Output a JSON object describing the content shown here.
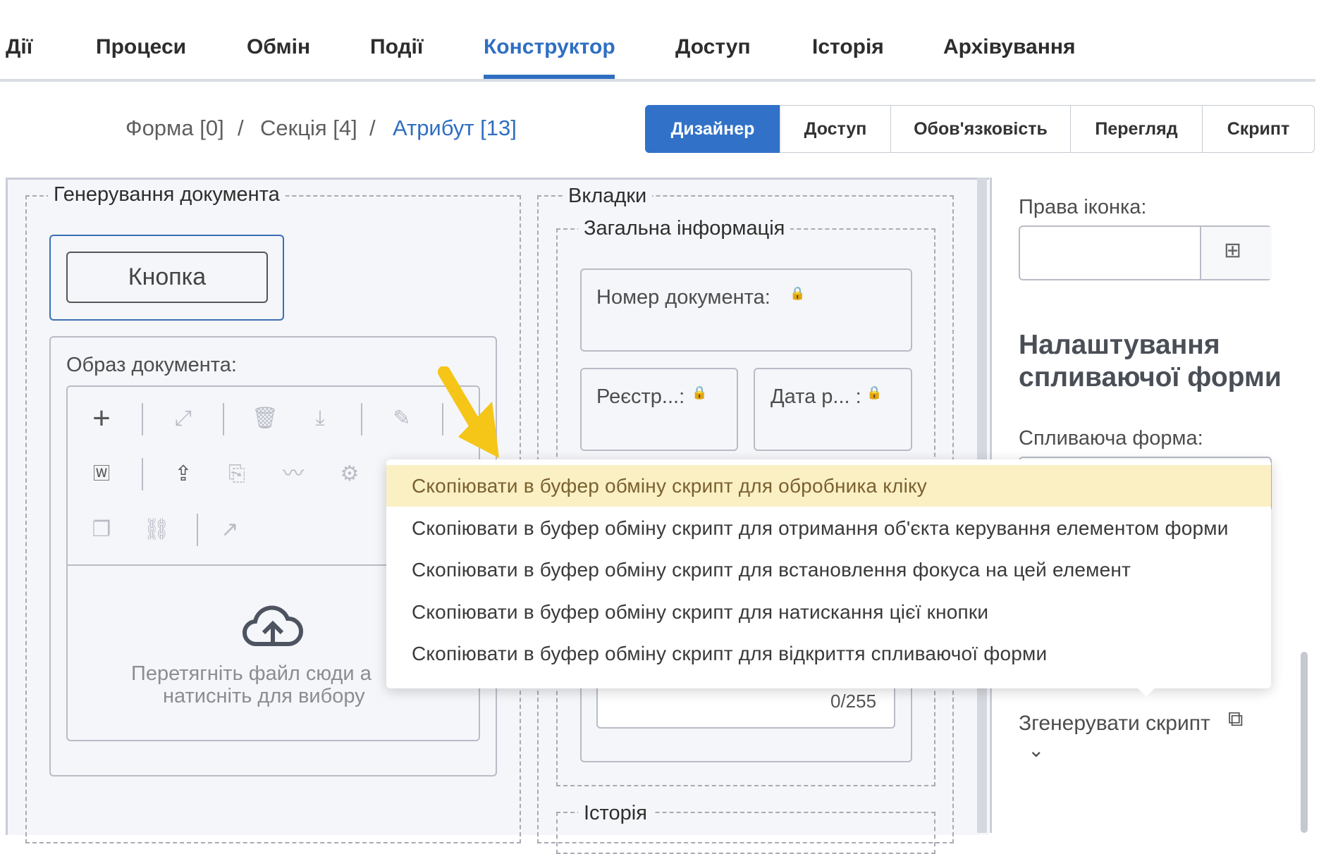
{
  "top_tabs": [
    {
      "label": "Дії"
    },
    {
      "label": "Процеси"
    },
    {
      "label": "Обмін"
    },
    {
      "label": "Події"
    },
    {
      "label": "Конструктор",
      "active": true
    },
    {
      "label": "Доступ"
    },
    {
      "label": "Історія"
    },
    {
      "label": "Архівування"
    }
  ],
  "breadcrumb": {
    "form": "Форма [0]",
    "section": "Секція [4]",
    "attribute": "Атрибут [13]",
    "separator": "/"
  },
  "mode_tabs": [
    {
      "label": "Дизайнер",
      "active": true
    },
    {
      "label": "Доступ"
    },
    {
      "label": "Обов'язковість"
    },
    {
      "label": "Перегляд"
    },
    {
      "label": "Скрипт"
    }
  ],
  "canvas": {
    "doc_gen_group": "Генерування документа",
    "button_label": "Кнопка",
    "doc_image_label": "Образ документа:",
    "upload_text_1": "Перетягніть файл сюди а",
    "upload_text_2": "натисніть для вибору",
    "tabs_group": "Вкладки",
    "general_info_group": "Загальна інформація",
    "doc_number_label": "Номер документа:",
    "reg_label": "Реєстр...:",
    "date_label": "Дата р... :",
    "char_counter": "0/255",
    "history_group": "Історія"
  },
  "right_panel": {
    "right_icon_label": "Права іконка:",
    "popup_settings_heading_1": "Налаштування",
    "popup_settings_heading_2": "спливаючої форми",
    "popup_form_label": "Спливаюча форма:",
    "generate_script_label": "Згенерувати скрипт"
  },
  "context_menu": {
    "items": [
      {
        "label": "Скопіювати в буфер обміну скрипт для обробника кліку",
        "highlighted": true
      },
      {
        "label": "Скопіювати в буфер обміну скрипт для отримання об'єкта керування елементом форми"
      },
      {
        "label": "Скопіювати в буфер обміну скрипт для встановлення фокуса на цей елемент"
      },
      {
        "label": "Скопіювати в буфер обміну скрипт для натискання цієї кнопки"
      },
      {
        "label": "Скопіювати в буфер обміну скрипт для відкриття спливаючої форми"
      }
    ]
  },
  "colors": {
    "accent": "#2f6fc1",
    "highlight": "#fbf0c4",
    "arrow": "#f5c518"
  }
}
